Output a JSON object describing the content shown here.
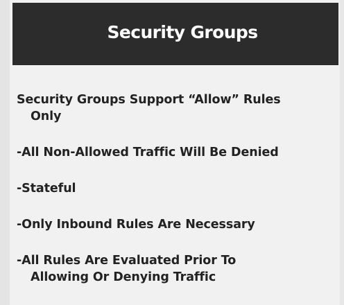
{
  "slide": {
    "title": "Security Groups",
    "points": [
      {
        "line1": "Security Groups Support “Allow” Rules",
        "line2": "Only"
      },
      {
        "line1": "-All Non-Allowed Traffic Will Be Denied"
      },
      {
        "line1": "-Stateful"
      },
      {
        "line1": "-Only Inbound Rules Are Necessary"
      },
      {
        "line1": "-All Rules Are Evaluated Prior To",
        "line2": "Allowing Or Denying Traffic"
      }
    ]
  },
  "colors": {
    "title_bar": "#2c2c2c",
    "title_text": "#ffffff",
    "body_text": "#222222",
    "background": "#f1f1f1"
  }
}
